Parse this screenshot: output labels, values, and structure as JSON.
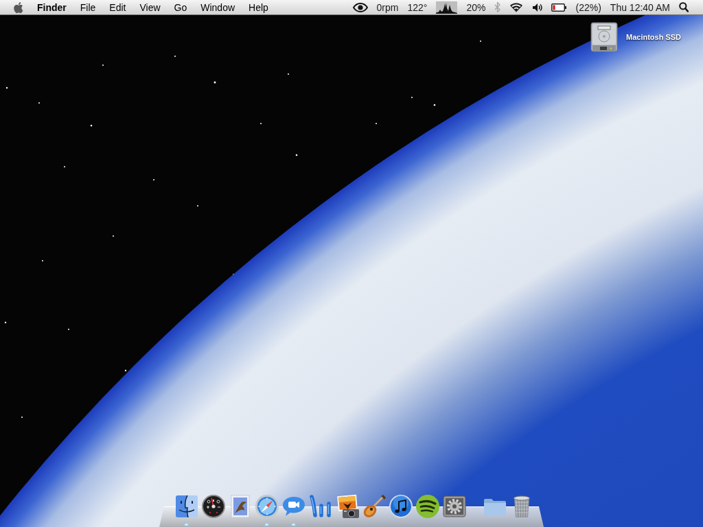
{
  "menu_bar": {
    "menus": [
      {
        "kind": "apple"
      },
      {
        "kind": "app",
        "label": "Finder"
      },
      {
        "kind": "menu",
        "label": "File"
      },
      {
        "kind": "menu",
        "label": "Edit"
      },
      {
        "kind": "menu",
        "label": "View"
      },
      {
        "kind": "menu",
        "label": "Go"
      },
      {
        "kind": "menu",
        "label": "Window"
      },
      {
        "kind": "menu",
        "label": "Help"
      }
    ],
    "status_items": [
      {
        "kind": "eye"
      },
      {
        "kind": "text",
        "text": "0rpm"
      },
      {
        "kind": "text",
        "text": "122°"
      },
      {
        "kind": "graph"
      },
      {
        "kind": "text",
        "text": "20%"
      },
      {
        "kind": "bluetooth",
        "on": false
      },
      {
        "kind": "wifi"
      },
      {
        "kind": "volume"
      },
      {
        "kind": "battery"
      },
      {
        "kind": "text",
        "text": "(22%)"
      },
      {
        "kind": "text",
        "text": "Thu 12:40 AM"
      },
      {
        "kind": "search"
      }
    ]
  },
  "desktop_icons": [
    {
      "kind": "drive",
      "label": "Macintosh SSD"
    }
  ],
  "dock": {
    "sections": [
      {
        "items": [
          {
            "kind": "face",
            "running": true
          },
          {
            "kind": "gauge",
            "running": false
          },
          {
            "kind": "stamp",
            "running": false
          },
          {
            "kind": "compass",
            "running": true
          },
          {
            "kind": "bubble",
            "running": true
          },
          {
            "kind": "bars",
            "running": false
          },
          {
            "kind": "photo",
            "running": false
          },
          {
            "kind": "guitar",
            "running": false
          },
          {
            "kind": "note",
            "running": false
          },
          {
            "kind": "waves",
            "running": false
          },
          {
            "kind": "gear",
            "running": false
          }
        ]
      },
      {
        "items": [
          {
            "kind": "folder",
            "running": false
          },
          {
            "kind": "trash",
            "running": false
          }
        ]
      }
    ]
  }
}
